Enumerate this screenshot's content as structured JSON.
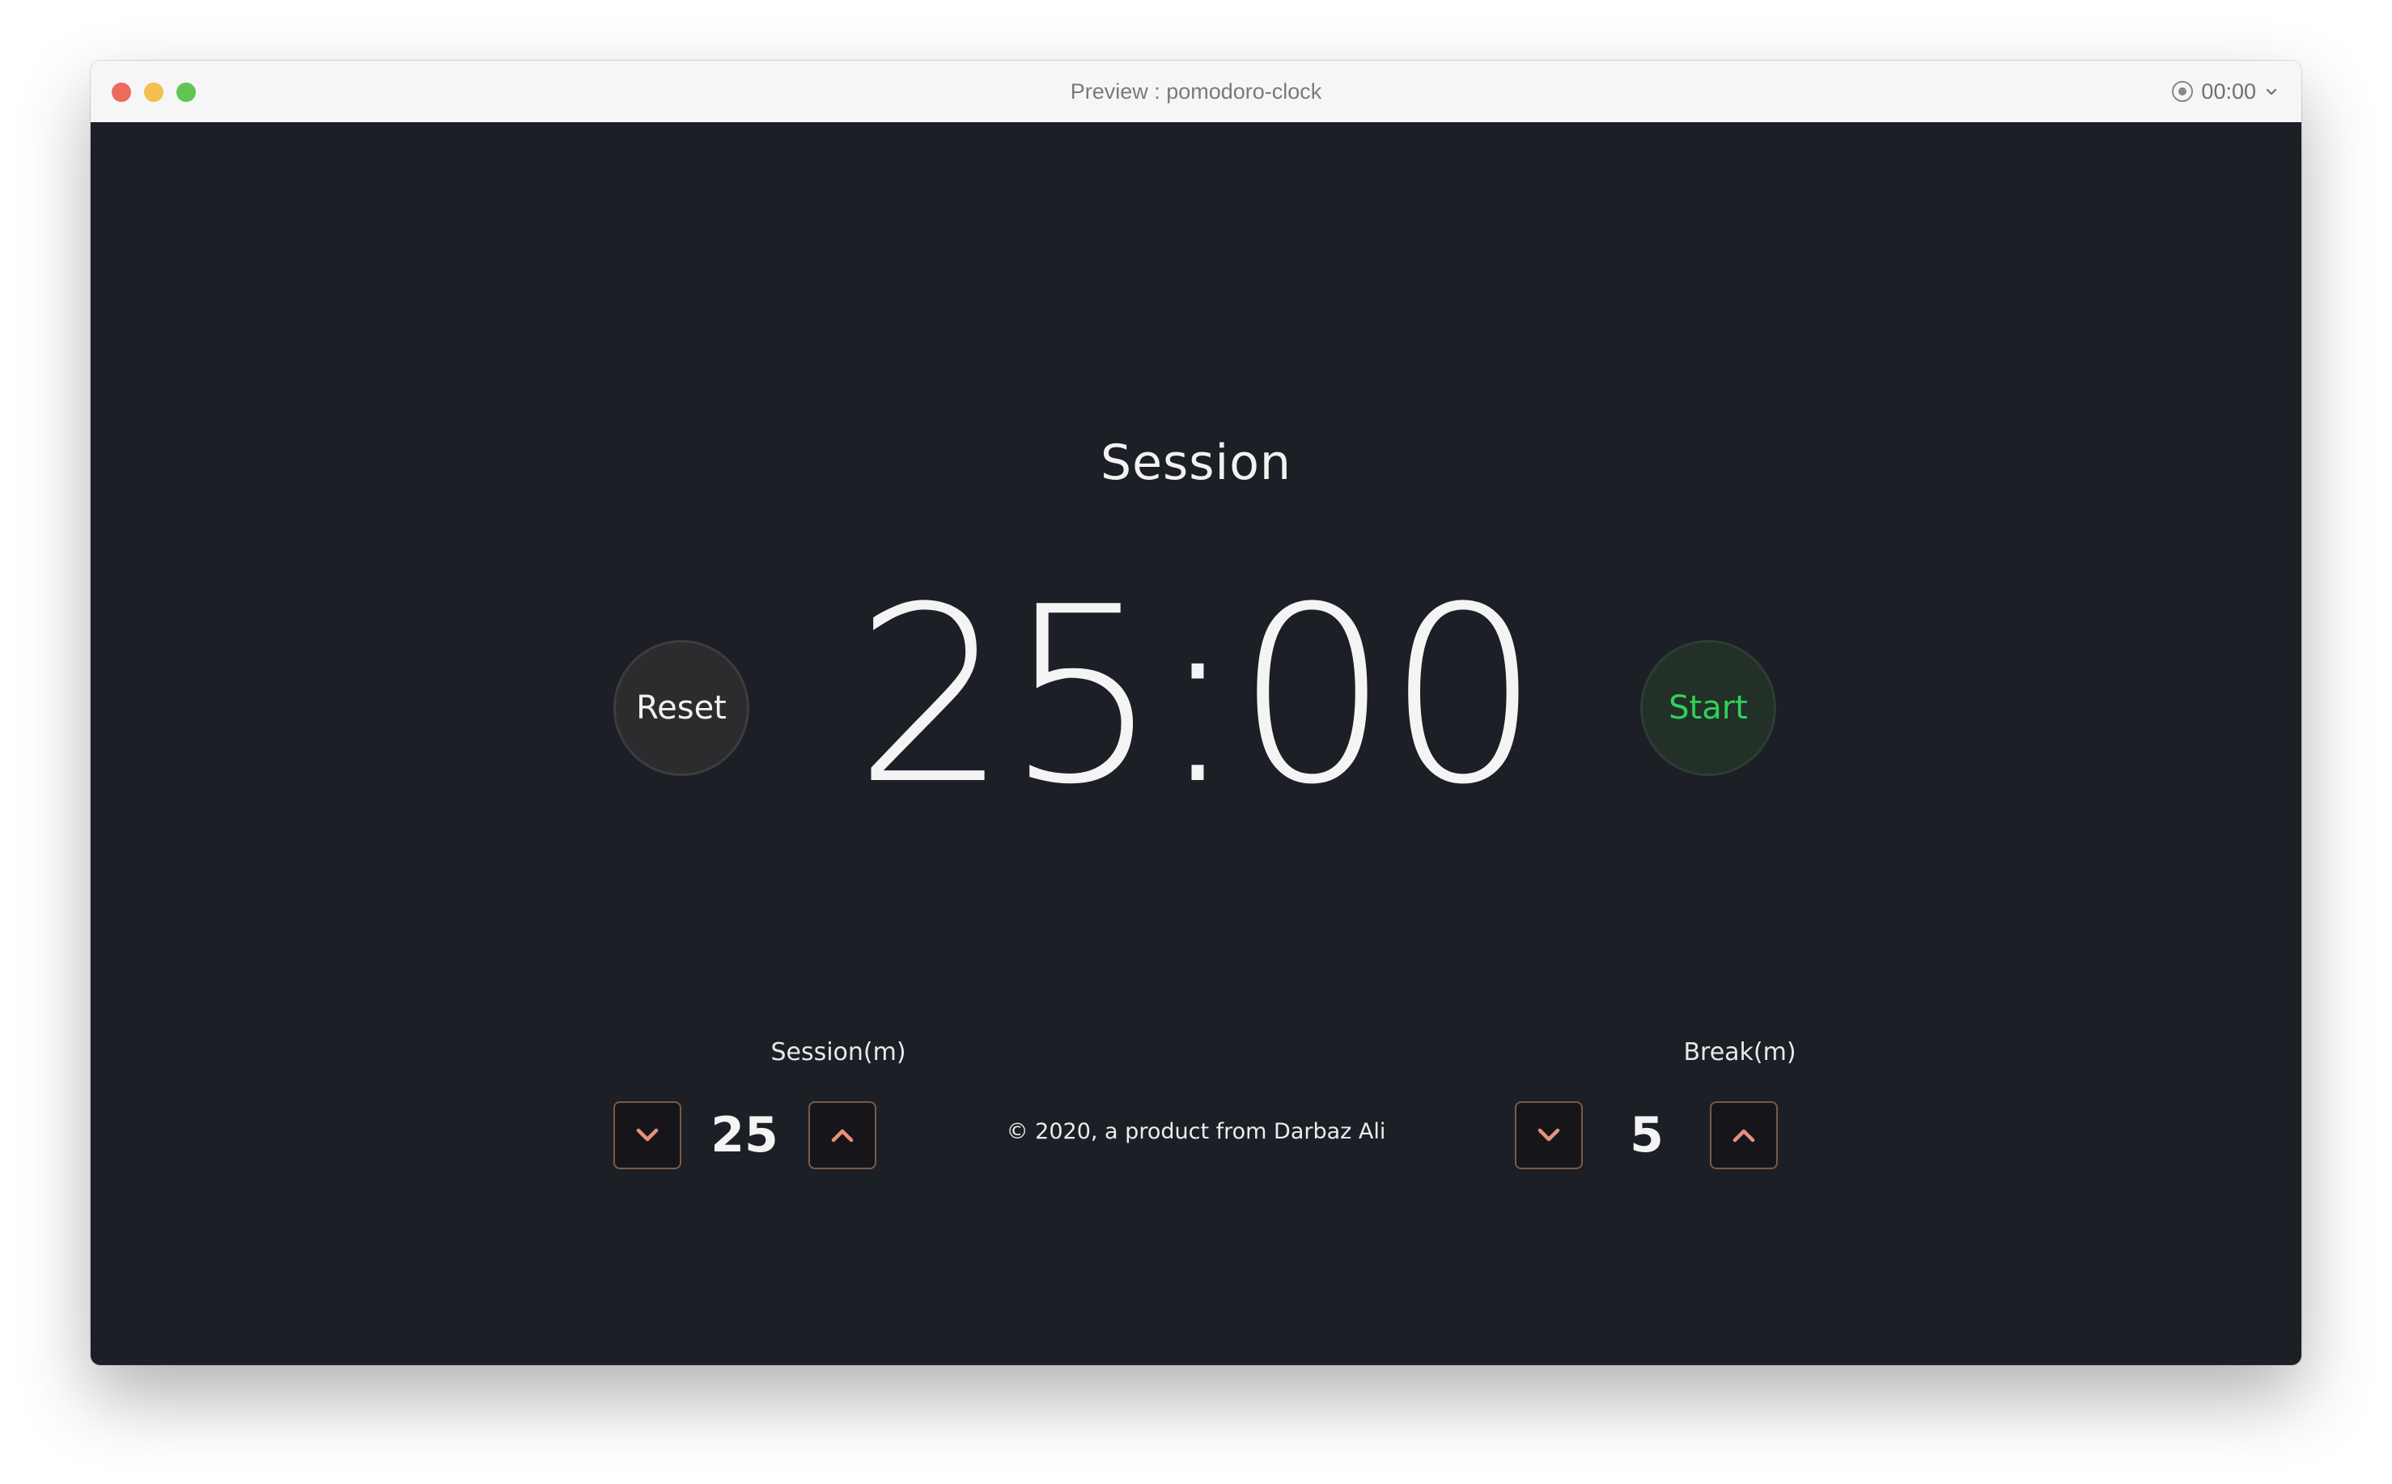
{
  "window": {
    "title": "Preview : pomodoro-clock",
    "recording_time": "00:00",
    "controls": {
      "close_color": "#ed6a5e",
      "minimize_color": "#f4bf4f",
      "zoom_color": "#61c554"
    }
  },
  "app": {
    "mode_label": "Session",
    "timer_display": "25:00",
    "reset_label": "Reset",
    "start_label": "Start",
    "session": {
      "label": "Session(m)",
      "value": "25",
      "decrement_icon": "chevron-down-icon",
      "increment_icon": "chevron-up-icon"
    },
    "break": {
      "label": "Break(m)",
      "value": "5",
      "decrement_icon": "chevron-down-icon",
      "increment_icon": "chevron-up-icon"
    },
    "footer_text": "© 2020, a product from Darbaz Ali"
  },
  "colors": {
    "background": "#1d1f26",
    "start_text": "#2fd158",
    "chevron": "#e8917a",
    "stepper_border": "#7a5a46"
  }
}
